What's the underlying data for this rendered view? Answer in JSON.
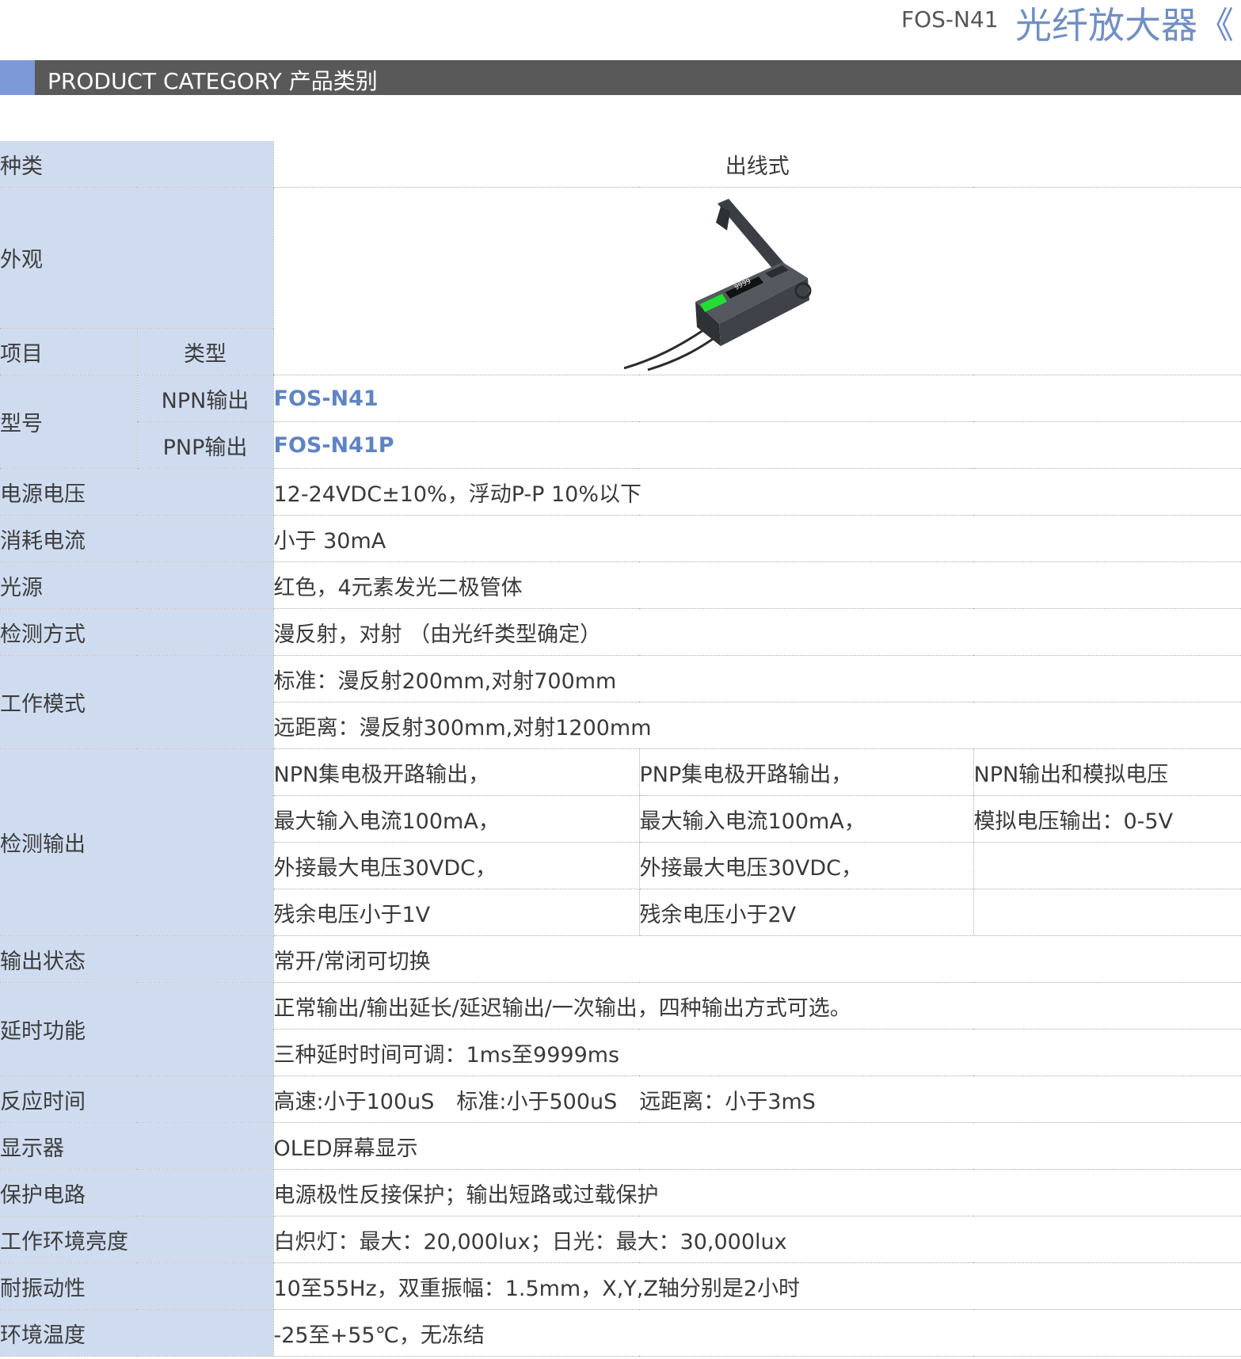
{
  "header": {
    "model": "FOS-N41",
    "title": "光纤放大器《"
  },
  "category_bar": {
    "label": "PRODUCT CATEGORY 产品类别"
  },
  "table": {
    "type_label": "种类",
    "type_value": "出线式",
    "appearance_label": "外观",
    "item_label": "项目",
    "kind_label": "类型",
    "model_label": "型号",
    "npn_label": "NPN输出",
    "npn_value": "FOS-N41",
    "pnp_label": "PNP输出",
    "pnp_value": "FOS-N41P",
    "supply_voltage_label": "电源电压",
    "supply_voltage_value": "12-24VDC±10%，浮动P-P 10%以下",
    "current_label": "消耗电流",
    "current_value": "小于 30mA",
    "light_source_label": "光源",
    "light_source_value": "红色，4元素发光二极管体",
    "detect_method_label": "检测方式",
    "detect_method_value": "漫反射，对射 （由光纤类型确定）",
    "work_mode_label": "工作模式",
    "work_mode_values": [
      "标准：漫反射200mm,对射700mm",
      "远距离：漫反射300mm,对射1200mm"
    ],
    "detect_output_label": "检测输出",
    "detect_output_col1": [
      "NPN集电极开路输出，",
      "最大输入电流100mA，",
      "外接最大电压30VDC，",
      "残余电压小于1V"
    ],
    "detect_output_col2": [
      "PNP集电极开路输出，",
      "最大输入电流100mA，",
      "外接最大电压30VDC，",
      "残余电压小于2V"
    ],
    "detect_output_col3": [
      "NPN输出和模拟电压",
      "模拟电压输出：0-5V"
    ],
    "output_state_label": "输出状态",
    "output_state_value": "常开/常闭可切换",
    "delay_label": "延时功能",
    "delay_values": [
      "正常输出/输出延长/延迟输出/一次输出，四种输出方式可选。",
      "三种延时时间可调：1ms至9999ms"
    ],
    "response_label": "反应时间",
    "response_values": [
      "高速:小于100uS",
      "标准:小于500uS",
      "远距离：小于3mS"
    ],
    "display_label": "显示器",
    "display_value": "OLED屏幕显示",
    "protection_label": "保护电路",
    "protection_value": "电源极性反接保护；输出短路或过载保护",
    "ambient_light_label": "工作环境亮度",
    "ambient_light_value": "白炽灯：最大：20,000lux；日光：最大：30,000lux",
    "vibration_label": "耐振动性",
    "vibration_value": "10至55Hz，双重振幅：1.5mm，X,Y,Z轴分别是2小时",
    "temperature_label": "环境温度",
    "temperature_value": "-25至+55℃，无冻结"
  },
  "product_image": {
    "display_digits": "9999",
    "accent_color": "#22dd33"
  }
}
